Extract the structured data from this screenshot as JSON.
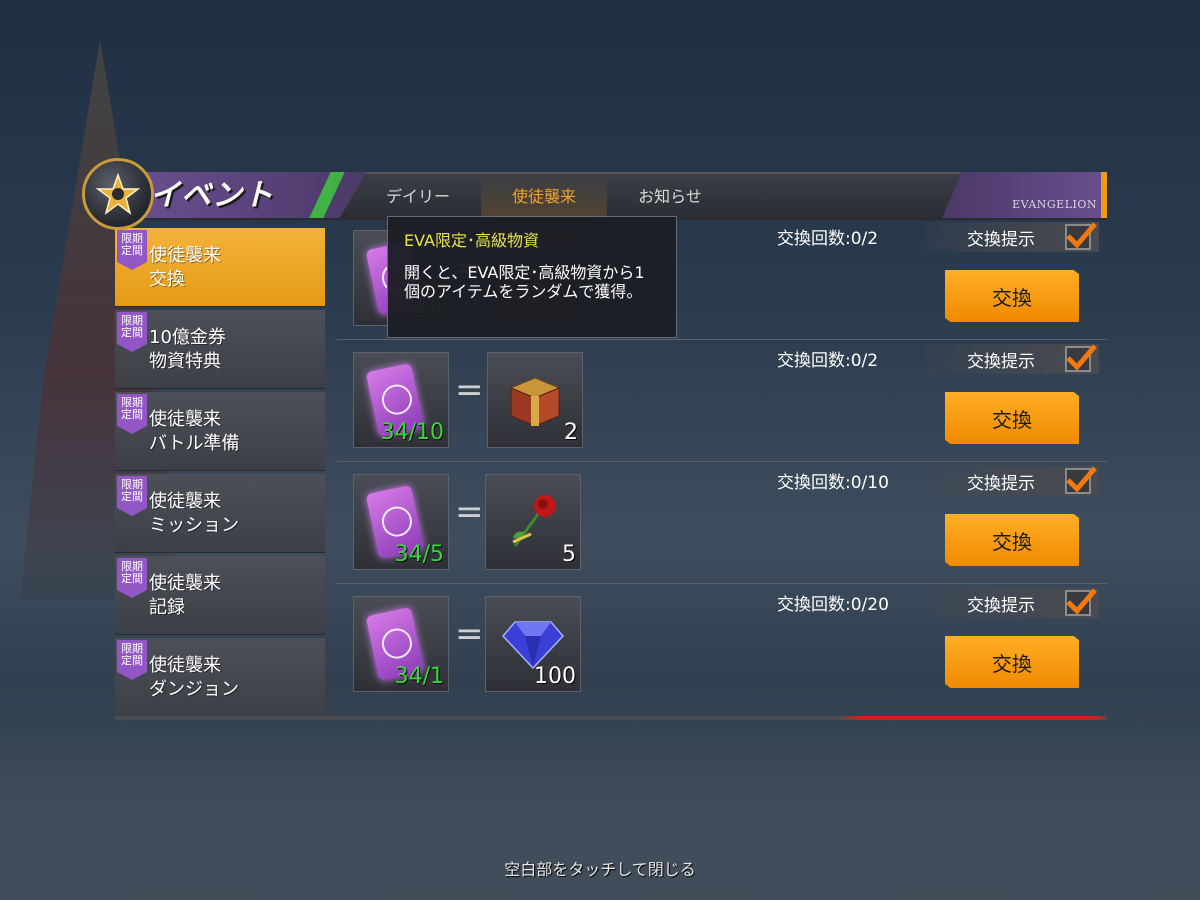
{
  "header": {
    "title": "イベント",
    "logo_mark": "EVANGELION",
    "tabs": [
      {
        "label": "デイリー",
        "active": false
      },
      {
        "label": "使徒襲来",
        "active": true
      },
      {
        "label": "お知らせ",
        "active": false
      }
    ]
  },
  "sidebar": {
    "badge_line1": "限期",
    "badge_line2": "定間",
    "items": [
      {
        "line1": "使徒襲来",
        "line2": "交換",
        "active": true
      },
      {
        "line1": "10億金券",
        "line2": "物資特典",
        "active": false
      },
      {
        "line1": "使徒襲来",
        "line2": "バトル準備",
        "active": false
      },
      {
        "line1": "使徒襲来",
        "line2": "ミッション",
        "active": false
      },
      {
        "line1": "使徒襲来",
        "line2": "記録",
        "active": false
      },
      {
        "line1": "使徒襲来",
        "line2": "ダンジョン",
        "active": false
      }
    ]
  },
  "exchange": {
    "hint_label": "交換提示",
    "button_label": "交換",
    "equals": "=",
    "rows": [
      {
        "cost": "34",
        "reward_icon": "eva-chest-icon",
        "limit": "交換回数:0/2",
        "hint_checked": true
      },
      {
        "cost": "34/10",
        "reward": "2",
        "reward_icon": "treasure-chest-icon",
        "limit": "交換回数:0/2",
        "hint_checked": true
      },
      {
        "cost": "34/5",
        "reward": "5",
        "reward_icon": "rose-icon",
        "limit": "交換回数:0/10",
        "hint_checked": true
      },
      {
        "cost": "34/1",
        "reward": "100",
        "reward_icon": "diamond-icon",
        "limit": "交換回数:0/20",
        "hint_checked": true
      }
    ]
  },
  "tooltip": {
    "title": "EVA限定･高級物資",
    "description": "開くと、EVA限定･高級物資から1個のアイテムをランダムで獲得。"
  },
  "footer": {
    "close_hint": "空白部をタッチして閉じる"
  },
  "colors": {
    "accent": "#f0a028",
    "button": "#f59512",
    "badge": "#9257c4",
    "count_green": "#39d63b",
    "tooltip_title": "#e8e24a"
  }
}
